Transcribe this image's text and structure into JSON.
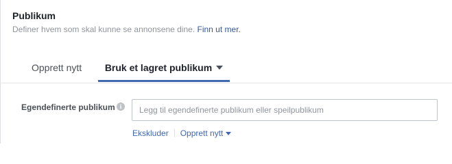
{
  "section": {
    "title": "Publikum",
    "description": "Definer hvem som skal kunne se annonsene dine.",
    "learn_more": "Finn ut mer."
  },
  "tabs": [
    {
      "label": "Opprett nytt",
      "active": false
    },
    {
      "label": "Bruk et lagret publikum",
      "active": true
    }
  ],
  "custom_audience": {
    "label": "Egendefinerte publikum",
    "info_icon": "i",
    "placeholder": "Legg til egendefinerte publikum eller speilpublikum",
    "value": ""
  },
  "actions": {
    "exclude": "Ekskluder",
    "create_new": "Opprett nytt"
  },
  "colors": {
    "accent": "#4267b2",
    "link": "#365899",
    "muted_text": "#90949c",
    "border": "#dddfe2"
  }
}
